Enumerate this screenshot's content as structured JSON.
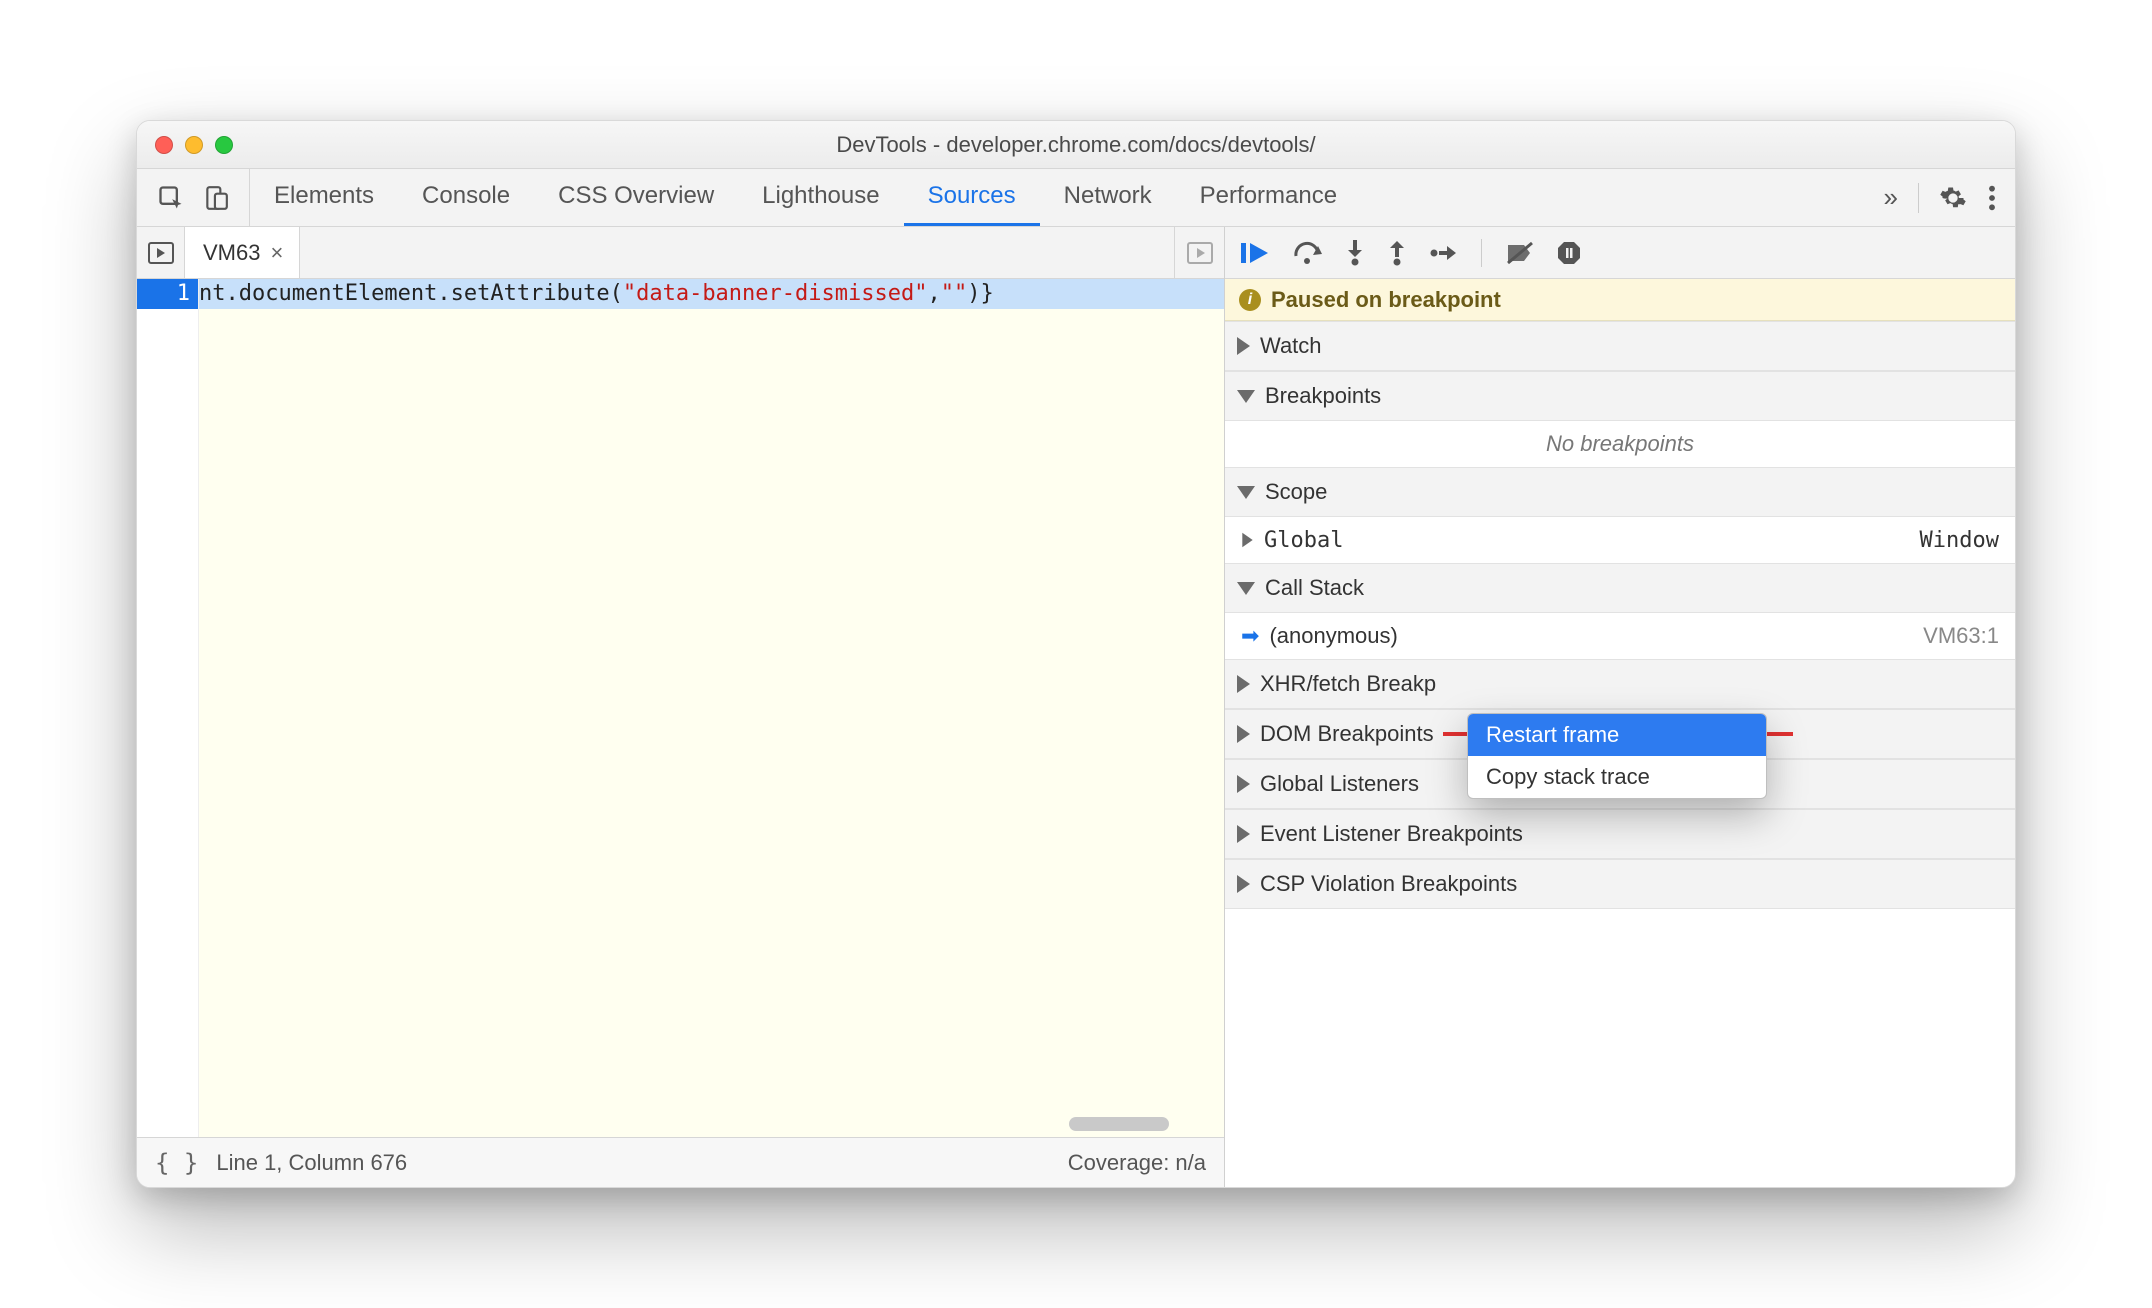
{
  "window": {
    "title": "DevTools - developer.chrome.com/docs/devtools/"
  },
  "tabs": {
    "items": [
      "Elements",
      "Console",
      "CSS Overview",
      "Lighthouse",
      "Sources",
      "Network",
      "Performance"
    ],
    "active_index": 4,
    "overflow_glyph": "»"
  },
  "file_tab": {
    "name": "VM63",
    "close_glyph": "×"
  },
  "editor": {
    "line_number": "1",
    "code_plain_prefix": "nt.documentElement.setAttribute(",
    "code_string1": "\"data-banner-dismissed\"",
    "code_mid": ",",
    "code_string2": "\"\"",
    "code_plain_suffix": ")}"
  },
  "status": {
    "cursor": "Line 1, Column 676",
    "coverage": "Coverage: n/a"
  },
  "debugger": {
    "paused_label": "Paused on breakpoint",
    "sections": {
      "watch": "Watch",
      "breakpoints": "Breakpoints",
      "breakpoints_empty": "No breakpoints",
      "scope": "Scope",
      "scope_global": "Global",
      "scope_global_value": "Window",
      "callstack": "Call Stack",
      "callstack_item": "(anonymous)",
      "callstack_loc": "VM63:1",
      "xhr": "XHR/fetch Breakp",
      "dom": "DOM Breakpoints",
      "global_listeners": "Global Listeners",
      "event_listener": "Event Listener Breakpoints",
      "csp": "CSP Violation Breakpoints"
    }
  },
  "context_menu": {
    "items": [
      "Restart frame",
      "Copy stack trace"
    ],
    "highlight_index": 0
  }
}
